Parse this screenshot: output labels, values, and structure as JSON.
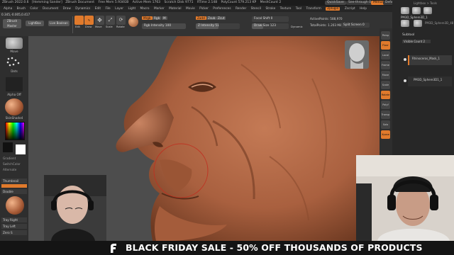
{
  "titlebar": {
    "app": "ZBrush 2022.0.6",
    "project": "[Hemming Sander]",
    "document": "ZBrush Document",
    "stats": [
      "Free Mem 5.934GB",
      "Active Mem 1763",
      "Scratch Disk 9771",
      "RTime 2.148",
      "PolyCount 579.213 KP",
      "MeshCount 2"
    ],
    "quicksave": "QuickSave",
    "seethrough": "See-through 0",
    "menus_label": "Menus",
    "script_label": "DefaultZScript"
  },
  "menubar": {
    "items": [
      "Alpha",
      "Brush",
      "Color",
      "Document",
      "Draw",
      "Dynamics",
      "Edit",
      "File",
      "Layer",
      "Light",
      "Macro",
      "Marker",
      "Material",
      "Movie",
      "Picker",
      "Preferences",
      "Render",
      "Stencil",
      "Stroke",
      "Texture",
      "Tool",
      "Transform",
      "Zplugin",
      "Zscript",
      "Help"
    ]
  },
  "coords": "0.345,-0.005,0.417",
  "shelf": {
    "home_page": "Home Page",
    "lightbox": "LightBox",
    "live_boolean": "Live Boolean",
    "bpr": "BPR",
    "zbrush_master": "ZBrush Master",
    "draw": "Draw",
    "move": "Move",
    "scale": "Scale",
    "rotate": "Rotate",
    "edit": "Edit",
    "mrgb": "Mrgb",
    "rgb": "Rgb",
    "m": "M",
    "zadd": "Zadd",
    "zsub": "Zsub",
    "zcut": "Zcut",
    "rgb_intensity": "Rgb Intensity",
    "rgb_intensity_val": "100",
    "z_intensity": "Z Intensity",
    "z_intensity_val": "51",
    "focal_shift": "Focal Shift",
    "focal_shift_val": "0",
    "draw_size": "Draw Size",
    "draw_size_val": "123",
    "dynamic": "Dynamic",
    "active_points": "ActivePoints: 588,970",
    "total_points": "TotalPoints: 1.203 Mil",
    "split_screen": "Split Screen",
    "split_screen_val": "0"
  },
  "lefttray": {
    "brush_name": "Move",
    "stroke_name": "Dots",
    "alpha_name": "Alpha Off",
    "texture_name": "Texture Off",
    "material_name": "SkinShade4",
    "gradient": "Gradient",
    "switch_color": "SwitchColor",
    "alternate": "Alternate",
    "thumbnail": "Thumbnail",
    "double": "Double",
    "tray_right": "Tray Right",
    "tray_left": "Tray Left",
    "zero_s": "Zero S"
  },
  "rightshelf": {
    "icons": [
      "Persp",
      "Floor",
      "Local",
      "Frame",
      "Move",
      "Scale",
      "Rotate",
      "Polyf",
      "Transp",
      "Solo",
      "Xpose"
    ]
  },
  "rightpanel": {
    "tool_name": "PM3D_Sphere3D_1",
    "subtool_title": "Subtool",
    "visible_count": "Visible Count 2",
    "items": [
      "Rhinoceros_Mask_1",
      "PM3D_Sphere3D1_1"
    ],
    "lightbox_tools": "Lightbox > Tools",
    "brush_count": "PM3D_Sphere3D_48"
  },
  "banner": {
    "text": "BLACK FRIDAY SALE - 50% OFF THOUSANDS OF PRODUCTS",
    "logo": "f-logo-icon"
  },
  "colors": {
    "accent": "#e07a2c",
    "clay": "#b06a48",
    "canvas_bg": "#4c4c4c",
    "banner_bg": "#141414"
  }
}
